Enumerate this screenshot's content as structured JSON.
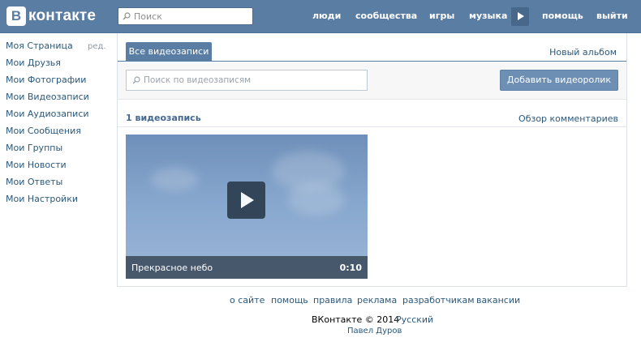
{
  "header": {
    "logo_letter": "В",
    "logo_text": "контакте",
    "search_placeholder": "Поиск",
    "nav": [
      "люди",
      "сообщества",
      "игры",
      "музыка",
      "помощь",
      "выйти"
    ],
    "icons": {
      "search": "search-icon",
      "player": "play-icon"
    }
  },
  "sidebar": {
    "edit_label": "ред.",
    "items": [
      "Моя Страница",
      "Мои Друзья",
      "Мои Фотографии",
      "Мои Видеозаписи",
      "Мои Аудиозаписи",
      "Мои Сообщения",
      "Мои Группы",
      "Мои Новости",
      "Мои Ответы",
      "Мои Настройки"
    ]
  },
  "main": {
    "tab_active": "Все видеозаписи",
    "new_album": "Новый альбом",
    "search_placeholder": "Поиск по видеозаписям",
    "add_button": "Добавить видеоролик",
    "count_label": "1 видеозапись",
    "comments_link": "Обзор комментариев",
    "video": {
      "title": "Прекрасное небо",
      "duration": "0:10"
    }
  },
  "footer": {
    "links": [
      "о сайте",
      "помощь",
      "правила",
      "реклама",
      "разработчикам",
      "вакансии"
    ],
    "copyright": "ВКонтакте © 2014",
    "language": "Русский",
    "author": "Павел Дуров"
  },
  "colors": {
    "header_bg": "#5a7da3",
    "link": "#2b587a",
    "tab_active": "#597da3",
    "button": "#6d8fb3"
  }
}
